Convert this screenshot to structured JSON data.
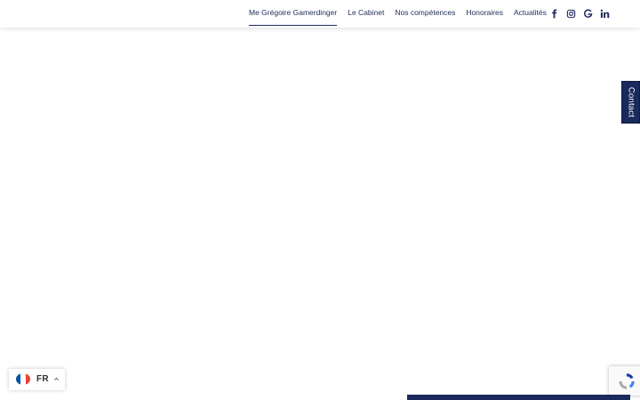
{
  "nav": {
    "items": [
      {
        "label": "Me Grégoire Gamerdinger",
        "active": true
      },
      {
        "label": "Le Cabinet",
        "active": false
      },
      {
        "label": "Nos compétences",
        "active": false
      },
      {
        "label": "Honoraires",
        "active": false
      },
      {
        "label": "Actualités",
        "active": false
      }
    ]
  },
  "social": {
    "icons": [
      "facebook-icon",
      "instagram-icon",
      "google-icon",
      "linkedin-icon"
    ],
    "color": "#1b2a5c"
  },
  "contact_tab": {
    "label": "Contact",
    "color": "#1b2a5c"
  },
  "language": {
    "code": "FR",
    "flag_colors": [
      "#0055a4",
      "#ffffff",
      "#ef4135"
    ]
  },
  "colors": {
    "brand": "#1b2a5c",
    "background": "#ffffff"
  }
}
